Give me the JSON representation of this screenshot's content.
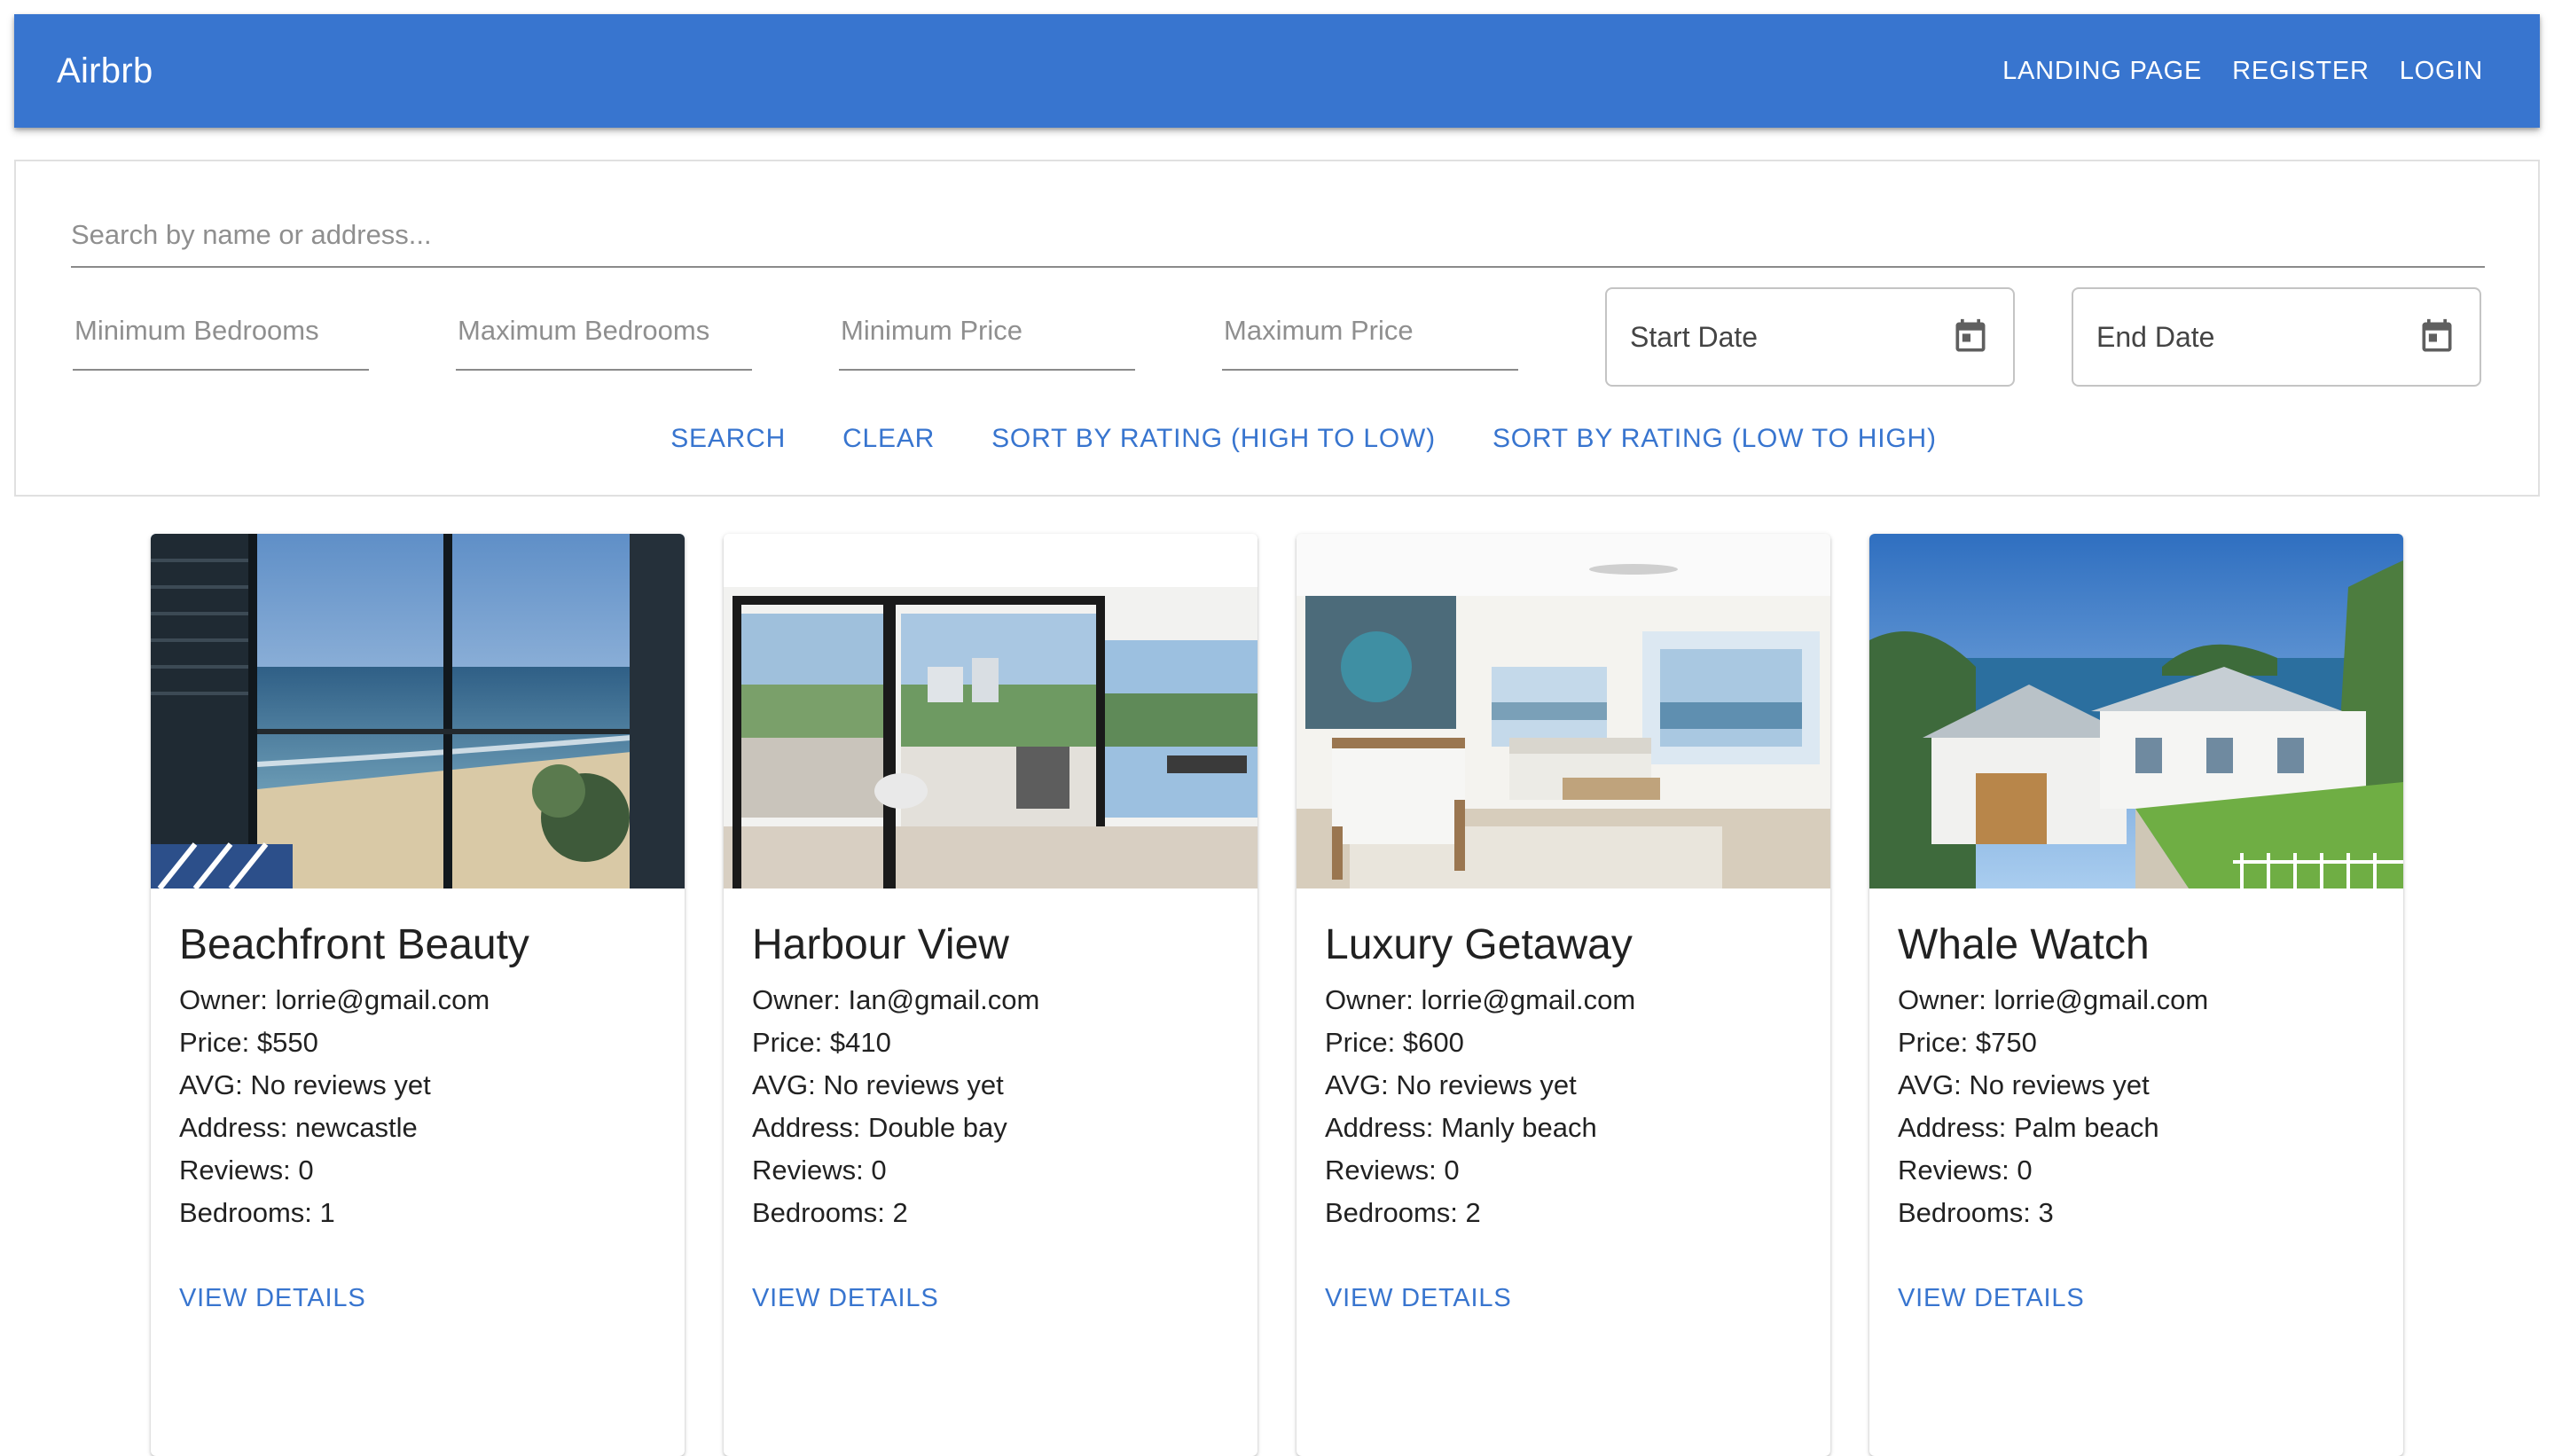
{
  "appbar": {
    "brand": "Airbrb",
    "nav": [
      "LANDING PAGE",
      "REGISTER",
      "LOGIN"
    ],
    "color": "#3875cf"
  },
  "search": {
    "placeholder": "Search by name or address...",
    "filters": [
      "Minimum Bedrooms",
      "Maximum Bedrooms",
      "Minimum Price",
      "Maximum Price"
    ],
    "start_date": "Start Date",
    "end_date": "End Date",
    "actions": [
      "SEARCH",
      "CLEAR",
      "SORT BY RATING (HIGH TO LOW)",
      "SORT BY RATING (LOW TO HIGH)"
    ]
  },
  "listings": [
    {
      "title": "Beachfront Beauty",
      "owner": "Owner: lorrie@gmail.com",
      "price": "Price: $550",
      "avg": "AVG: No reviews yet",
      "address": "Address: newcastle",
      "reviews": "Reviews: 0",
      "bedrooms": "Bedrooms: 1",
      "action": "VIEW DETAILS"
    },
    {
      "title": "Harbour View",
      "owner": "Owner: Ian@gmail.com",
      "price": "Price: $410",
      "avg": "AVG: No reviews yet",
      "address": "Address: Double bay",
      "reviews": "Reviews: 0",
      "bedrooms": "Bedrooms: 2",
      "action": "VIEW DETAILS"
    },
    {
      "title": "Luxury Getaway",
      "owner": "Owner: lorrie@gmail.com",
      "price": "Price: $600",
      "avg": "AVG: No reviews yet",
      "address": "Address: Manly beach",
      "reviews": "Reviews: 0",
      "bedrooms": "Bedrooms: 2",
      "action": "VIEW DETAILS"
    },
    {
      "title": "Whale Watch",
      "owner": "Owner: lorrie@gmail.com",
      "price": "Price: $750",
      "avg": "AVG: No reviews yet",
      "address": "Address: Palm beach",
      "reviews": "Reviews: 0",
      "bedrooms": "Bedrooms: 3",
      "action": "VIEW DETAILS"
    }
  ]
}
